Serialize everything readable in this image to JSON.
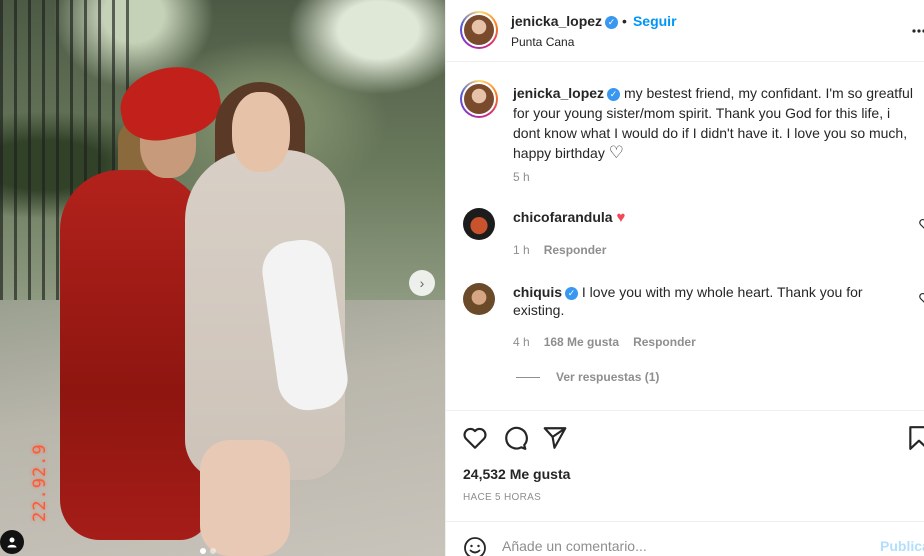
{
  "post": {
    "date_stamp": "22.92.9",
    "carousel_next": "›"
  },
  "header": {
    "username": "jenicka_lopez",
    "verified_mark": "✓",
    "separator": "•",
    "follow_label": "Seguir",
    "location": "Punta Cana"
  },
  "caption": {
    "username": "jenicka_lopez",
    "text": "my bestest friend, my confidant. I'm so greatful for your young sister/mom spirit. Thank you God for this life, i dont know what I would do if I didn't have it. I love you so much, happy birthday",
    "heart": "♡",
    "time": "5 h"
  },
  "comments": [
    {
      "username": "chicofarandula",
      "text": "",
      "emoji": "♥",
      "time": "1 h",
      "likes": "",
      "reply_label": "Responder"
    },
    {
      "username": "chiquis",
      "verified": true,
      "text": "I love you with my whole heart. Thank you for existing.",
      "time": "4 h",
      "likes": "168 Me gusta",
      "reply_label": "Responder"
    }
  ],
  "view_replies": "Ver respuestas (1)",
  "likes_count": "24,532 Me gusta",
  "posted_time": "HACE 5 HORAS",
  "add_comment": {
    "placeholder": "Añade un comentario...",
    "publish_label": "Publicar"
  },
  "colors": {
    "follow_blue": "#0095f6",
    "verified_blue": "#3897f0",
    "heart_red": "#ed4956",
    "date_stamp_orange": "#ff5a36"
  },
  "icons": {
    "like": "heart-outline-icon",
    "comment": "speech-bubble-icon",
    "share": "paper-plane-icon",
    "save": "bookmark-icon",
    "emoji": "smiley-icon"
  }
}
